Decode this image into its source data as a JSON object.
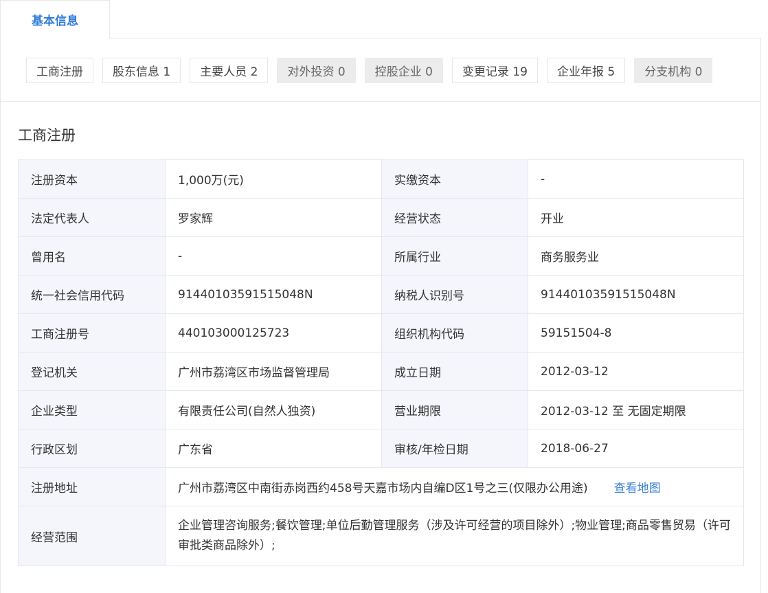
{
  "main_tab": {
    "label": "基本信息"
  },
  "subtabs": [
    {
      "label": "工商注册",
      "disabled": false
    },
    {
      "label": "股东信息 1",
      "disabled": false
    },
    {
      "label": "主要人员 2",
      "disabled": false
    },
    {
      "label": "对外投资 0",
      "disabled": true
    },
    {
      "label": "控股企业 0",
      "disabled": true
    },
    {
      "label": "变更记录 19",
      "disabled": false
    },
    {
      "label": "企业年报 5",
      "disabled": false
    },
    {
      "label": "分支机构 0",
      "disabled": true
    }
  ],
  "section": {
    "title": "工商注册"
  },
  "table": {
    "rows": [
      {
        "l1": "注册资本",
        "v1": "1,000万(元)",
        "l2": "实缴资本",
        "v2": "-"
      },
      {
        "l1": "法定代表人",
        "v1": "罗家辉",
        "l2": "经营状态",
        "v2": "开业"
      },
      {
        "l1": "曾用名",
        "v1": "-",
        "l2": "所属行业",
        "v2": "商务服务业"
      },
      {
        "l1": "统一社会信用代码",
        "v1": "91440103591515048N",
        "l2": "纳税人识别号",
        "v2": "91440103591515048N"
      },
      {
        "l1": "工商注册号",
        "v1": "440103000125723",
        "l2": "组织机构代码",
        "v2": "59151504-8"
      },
      {
        "l1": "登记机关",
        "v1": "广州市荔湾区市场监督管理局",
        "l2": "成立日期",
        "v2": "2012-03-12"
      },
      {
        "l1": "企业类型",
        "v1": "有限责任公司(自然人独资)",
        "l2": "营业期限",
        "v2": "2012-03-12 至 无固定期限"
      },
      {
        "l1": "行政区划",
        "v1": "广东省",
        "l2": "审核/年检日期",
        "v2": "2018-06-27"
      }
    ],
    "address": {
      "label": "注册地址",
      "value": "广州市荔湾区中南街赤岗西约458号天嘉市场内自编D区1号之三(仅限办公用途)",
      "link": "查看地图"
    },
    "scope": {
      "label": "经营范围",
      "value": "企业管理咨询服务;餐饮管理;单位后勤管理服务（涉及许可经营的项目除外）;物业管理;商品零售贸易（许可审批类商品除外）;"
    }
  }
}
